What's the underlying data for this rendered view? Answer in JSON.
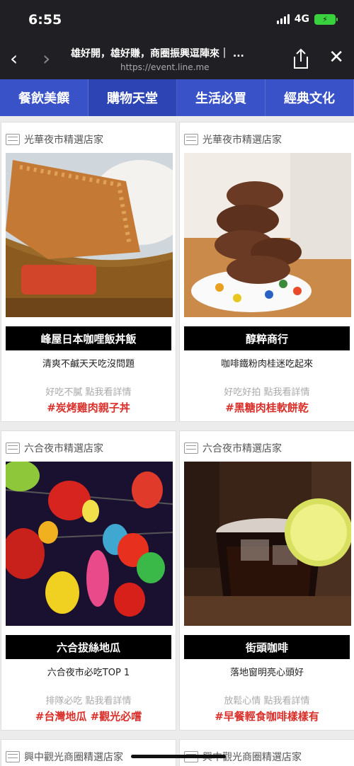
{
  "status": {
    "time": "6:55",
    "network": "4G"
  },
  "browser": {
    "title": "雄好開，雄好賺，商圈振興逗陣來｜ ...",
    "url": "https://event.line.me"
  },
  "tabs": [
    "餐飲美饌",
    "購物天堂",
    "生活必買",
    "經典文化"
  ],
  "cards": [
    {
      "store": "光華夜市精選店家",
      "name": "峰屋日本咖哩飯丼飯",
      "desc": "清爽不鹹天天吃沒問題",
      "hint": "好吃不膩 點我看詳情",
      "tags": "#炭烤雞肉親子丼",
      "photo": "curry"
    },
    {
      "store": "光華夜市精選店家",
      "name": "醇粹商行",
      "desc": "咖啡鐵粉肉桂迷吃起來",
      "hint": "好吃好拍 點我看詳情",
      "tags": "#黑糖肉桂軟餅乾",
      "photo": "cookies"
    },
    {
      "store": "六合夜市精選店家",
      "name": "六合拔絲地瓜",
      "desc": "六合夜市必吃TOP 1",
      "hint": "排隊必吃 點我看詳情",
      "tags": "#台灣地瓜 #觀光必嚐",
      "photo": "lanterns"
    },
    {
      "store": "六合夜市精選店家",
      "name": "街頭咖啡",
      "desc": "落地窗明亮心頭好",
      "hint": "放鬆心情 點我看詳情",
      "tags": "#早餐輕食咖啡樣樣有",
      "photo": "coffee"
    }
  ],
  "bottom": [
    "興中觀光商圈精選店家",
    "興中觀光商圈精選店家"
  ]
}
